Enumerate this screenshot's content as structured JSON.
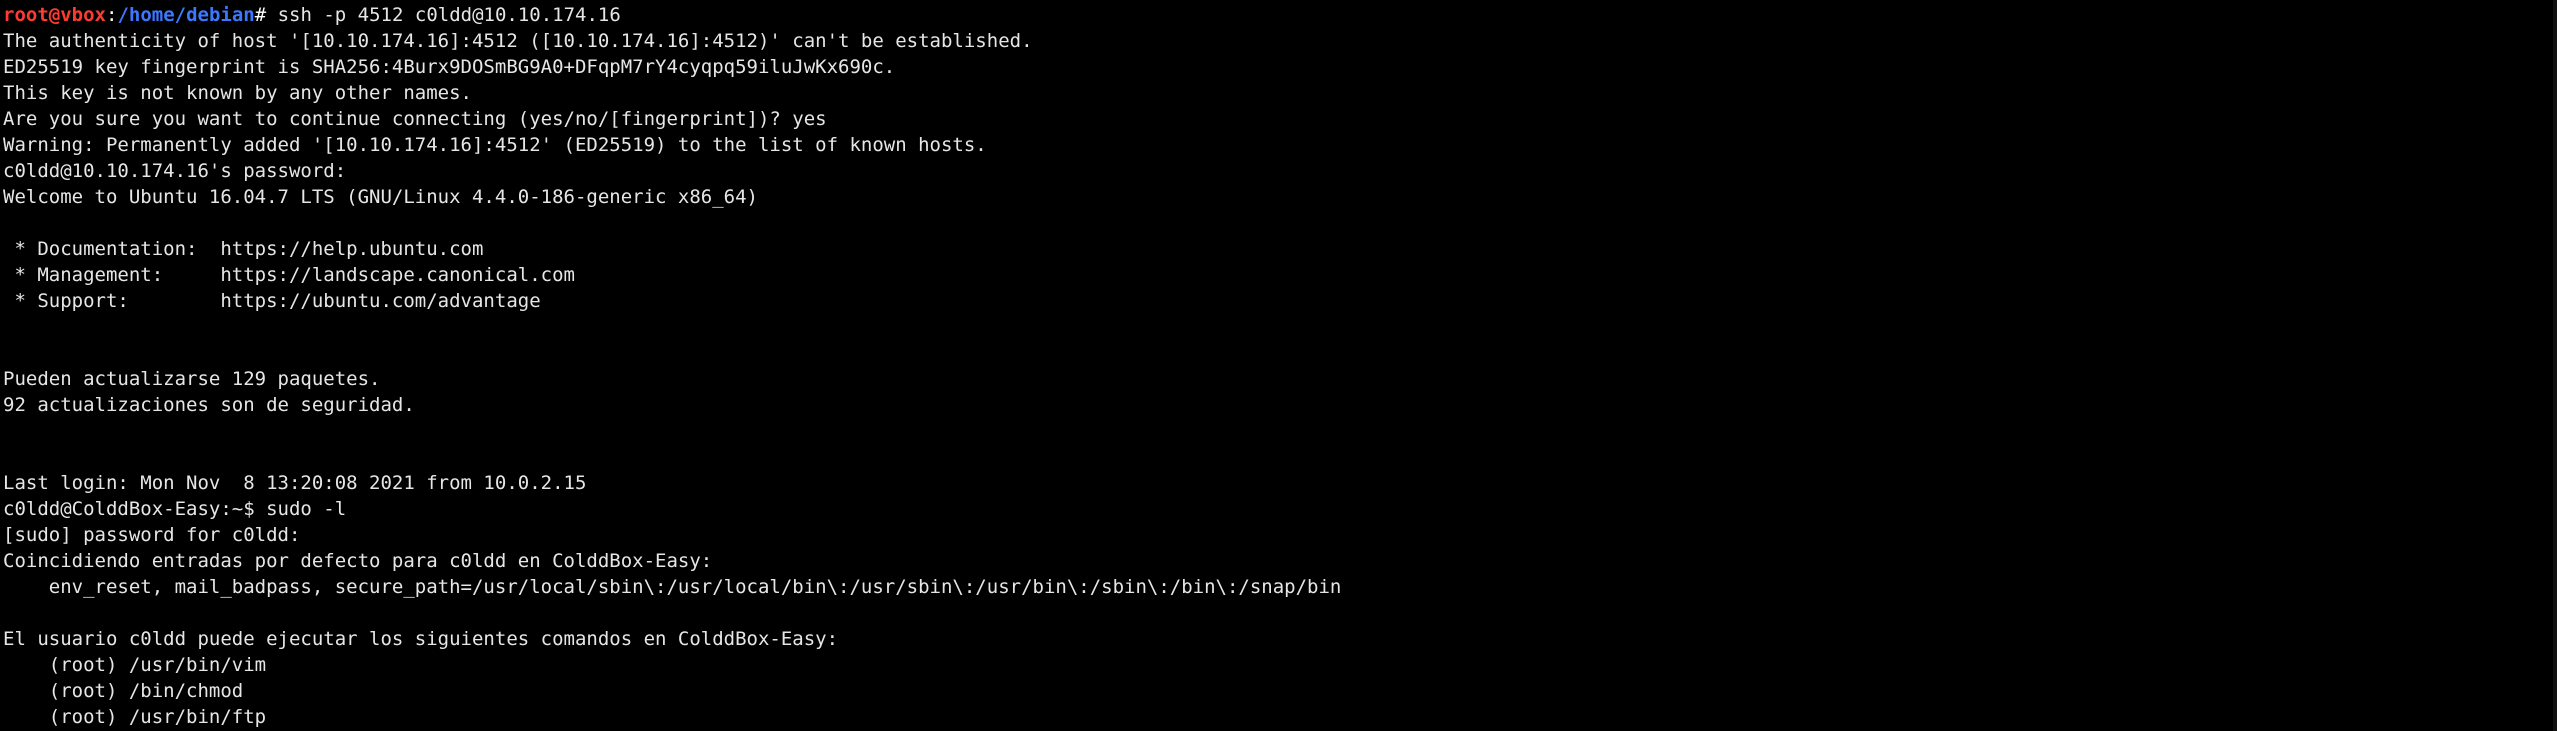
{
  "terminal": {
    "prompt": {
      "user": "root",
      "at": "@",
      "host": "vbox",
      "colon": ":",
      "path": "/home/debian",
      "symbol": "# ",
      "command": "ssh -p 4512 c0ldd@10.10.174.16"
    },
    "lines": [
      "The authenticity of host '[10.10.174.16]:4512 ([10.10.174.16]:4512)' can't be established.",
      "ED25519 key fingerprint is SHA256:4Burx9DOSmBG9A0+DFqpM7rY4cyqpq59iluJwKx690c.",
      "This key is not known by any other names.",
      "Are you sure you want to continue connecting (yes/no/[fingerprint])? yes",
      "Warning: Permanently added '[10.10.174.16]:4512' (ED25519) to the list of known hosts.",
      "c0ldd@10.10.174.16's password:",
      "Welcome to Ubuntu 16.04.7 LTS (GNU/Linux 4.4.0-186-generic x86_64)",
      "",
      " * Documentation:  https://help.ubuntu.com",
      " * Management:     https://landscape.canonical.com",
      " * Support:        https://ubuntu.com/advantage",
      "",
      "",
      "Pueden actualizarse 129 paquetes.",
      "92 actualizaciones son de seguridad.",
      "",
      "",
      "Last login: Mon Nov  8 13:20:08 2021 from 10.0.2.15",
      "c0ldd@ColddBox-Easy:~$ sudo -l",
      "[sudo] password for c0ldd:",
      "Coincidiendo entradas por defecto para c0ldd en ColddBox-Easy:",
      "    env_reset, mail_badpass, secure_path=/usr/local/sbin\\:/usr/local/bin\\:/usr/sbin\\:/usr/bin\\:/sbin\\:/bin\\:/snap/bin",
      "",
      "El usuario c0ldd puede ejecutar los siguientes comandos en ColddBox-Easy:",
      "    (root) /usr/bin/vim",
      "    (root) /bin/chmod",
      "    (root) /usr/bin/ftp"
    ]
  },
  "colors": {
    "background": "#000000",
    "text": "#e6e6e6",
    "prompt_user": "#ff3b30",
    "prompt_path": "#3b78ff"
  }
}
